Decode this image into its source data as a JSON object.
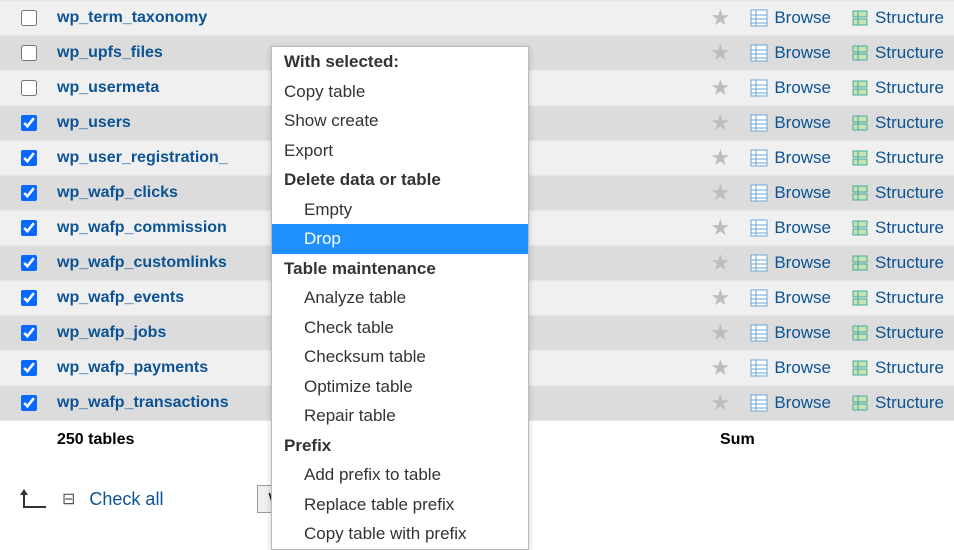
{
  "tables": [
    {
      "name": "wp_term_taxonomy",
      "checked": false,
      "rowClass": "odd"
    },
    {
      "name": "wp_upfs_files",
      "checked": false,
      "rowClass": "even"
    },
    {
      "name": "wp_usermeta",
      "checked": false,
      "rowClass": "odd"
    },
    {
      "name": "wp_users",
      "checked": true,
      "rowClass": "even"
    },
    {
      "name": "wp_user_registration_",
      "checked": true,
      "rowClass": "odd"
    },
    {
      "name": "wp_wafp_clicks",
      "checked": true,
      "rowClass": "even"
    },
    {
      "name": "wp_wafp_commission",
      "checked": true,
      "rowClass": "odd"
    },
    {
      "name": "wp_wafp_customlinks",
      "checked": true,
      "rowClass": "even"
    },
    {
      "name": "wp_wafp_events",
      "checked": true,
      "rowClass": "odd"
    },
    {
      "name": "wp_wafp_jobs",
      "checked": true,
      "rowClass": "even"
    },
    {
      "name": "wp_wafp_payments",
      "checked": true,
      "rowClass": "odd"
    },
    {
      "name": "wp_wafp_transactions",
      "checked": true,
      "rowClass": "even"
    }
  ],
  "actions": {
    "browse": "Browse",
    "structure": "Structure"
  },
  "summary": {
    "count_label": "250 tables",
    "sum_label": "Sum"
  },
  "footer": {
    "check_all": "Check all",
    "select_label": "With selected:"
  },
  "menu": [
    {
      "label": "With selected:",
      "type": "head"
    },
    {
      "label": "Copy table",
      "type": "item"
    },
    {
      "label": "Show create",
      "type": "item"
    },
    {
      "label": "Export",
      "type": "item"
    },
    {
      "label": "Delete data or table",
      "type": "head"
    },
    {
      "label": "Empty",
      "type": "sub"
    },
    {
      "label": "Drop",
      "type": "sub",
      "highlight": true
    },
    {
      "label": "Table maintenance",
      "type": "head"
    },
    {
      "label": "Analyze table",
      "type": "sub"
    },
    {
      "label": "Check table",
      "type": "sub"
    },
    {
      "label": "Checksum table",
      "type": "sub"
    },
    {
      "label": "Optimize table",
      "type": "sub"
    },
    {
      "label": "Repair table",
      "type": "sub"
    },
    {
      "label": "Prefix",
      "type": "head"
    },
    {
      "label": "Add prefix to table",
      "type": "sub"
    },
    {
      "label": "Replace table prefix",
      "type": "sub"
    },
    {
      "label": "Copy table with prefix",
      "type": "sub"
    }
  ]
}
